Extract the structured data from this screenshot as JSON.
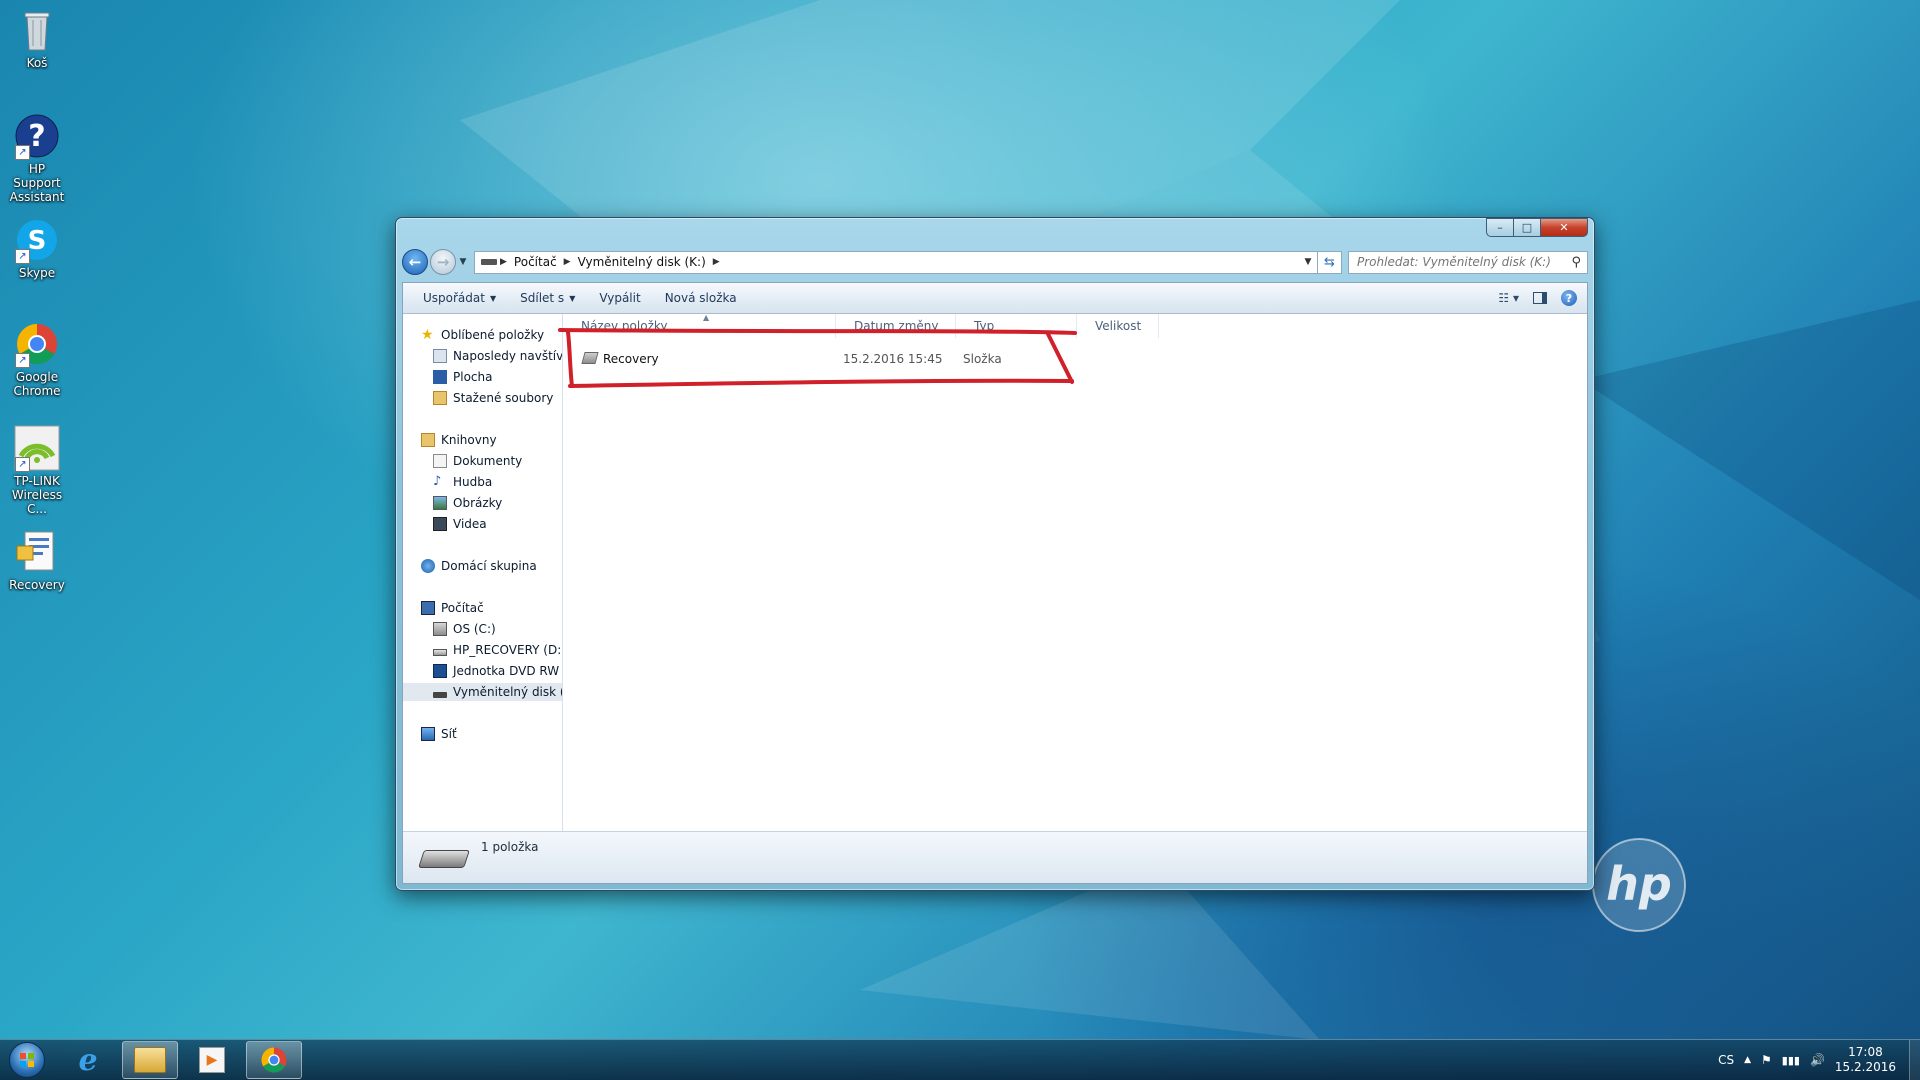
{
  "desktop": {
    "icons": [
      {
        "label": "Koš"
      },
      {
        "label": "HP Support Assistant"
      },
      {
        "label": "Skype"
      },
      {
        "label": "Google Chrome"
      },
      {
        "label": "TP-LINK Wireless C..."
      },
      {
        "label": "Recovery"
      }
    ]
  },
  "explorer": {
    "window_buttons": {
      "minimize": "–",
      "maximize": "□",
      "close": "✕"
    },
    "address": {
      "crumbs": [
        "Počítač",
        "Vyměnitelný disk (K:)"
      ]
    },
    "search": {
      "placeholder": "Prohledat: Vyměnitelný disk (K:)"
    },
    "toolbar": {
      "organize": "Uspořádat",
      "share": "Sdílet s",
      "burn": "Vypálit",
      "new_folder": "Nová složka"
    },
    "nav": {
      "favorites": "Oblíbené položky",
      "recent": "Naposledy navštíven",
      "desktop": "Plocha",
      "downloads": "Stažené soubory",
      "libraries": "Knihovny",
      "documents": "Dokumenty",
      "music": "Hudba",
      "pictures": "Obrázky",
      "videos": "Videa",
      "homegroup": "Domácí skupina",
      "computer": "Počítač",
      "os_drive": "OS (C:)",
      "recovery_drive": "HP_RECOVERY (D:)",
      "dvd_drive": "Jednotka DVD RW (E",
      "removable_drive": "Vyměnitelný disk (K:",
      "network": "Síť"
    },
    "columns": {
      "name": "Název položky",
      "date": "Datum změny",
      "type": "Typ",
      "size": "Velikost"
    },
    "files": [
      {
        "name": "Recovery",
        "date": "15.2.2016 15:45",
        "type": "Složka",
        "size": ""
      }
    ],
    "status": {
      "count": "1 položka"
    }
  },
  "taskbar": {
    "tray": {
      "language": "CS",
      "time": "17:08",
      "date": "15.2.2016"
    }
  },
  "brand": {
    "logo_text": "hp"
  },
  "colors": {
    "annotation": "#d0202a",
    "accent": "#1d63b8"
  }
}
